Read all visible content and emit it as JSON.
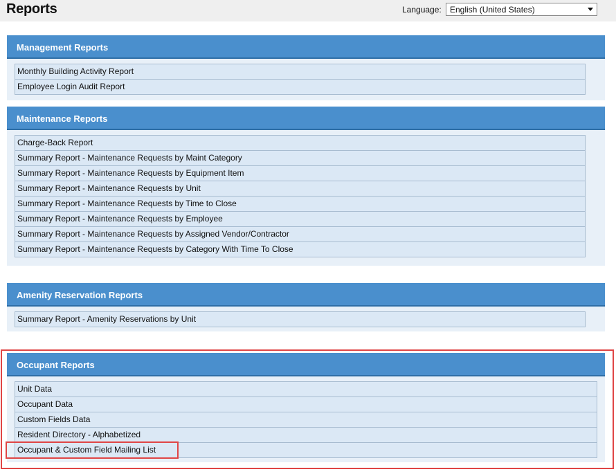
{
  "header": {
    "title": "Reports",
    "language_label": "Language:",
    "language_selected": "English (United States)"
  },
  "sections": [
    {
      "title": "Management Reports",
      "items": [
        "Monthly Building Activity Report",
        "Employee Login Audit Report"
      ]
    },
    {
      "title": "Maintenance Reports",
      "items": [
        "Charge-Back Report",
        "Summary Report - Maintenance Requests by Maint Category",
        "Summary Report - Maintenance Requests by Equipment Item",
        "Summary Report - Maintenance Requests by Unit",
        "Summary Report - Maintenance Requests by Time to Close",
        "Summary Report - Maintenance Requests by Employee",
        "Summary Report - Maintenance Requests by Assigned Vendor/Contractor",
        "Summary Report - Maintenance Requests by Category With Time To Close"
      ]
    },
    {
      "title": "Amenity Reservation Reports",
      "items": [
        "Summary Report - Amenity Reservations by Unit"
      ]
    },
    {
      "title": "Occupant Reports",
      "items": [
        "Unit Data",
        "Occupant Data",
        "Custom Fields Data",
        "Resident Directory - Alphabetized",
        "Occupant & Custom Field Mailing List"
      ]
    }
  ],
  "colors": {
    "header_blue": "#4a8fcd",
    "panel_bg": "#e8f0f8",
    "row_bg": "#dbe8f5",
    "highlight_red": "#e04545"
  }
}
